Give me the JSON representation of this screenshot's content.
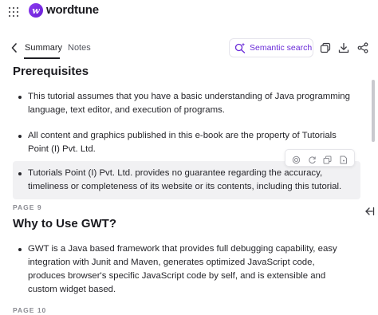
{
  "app": {
    "brand": "wordtune",
    "logo_letter": "w"
  },
  "tabs": [
    {
      "label": "Summary",
      "active": true
    },
    {
      "label": "Notes",
      "active": false
    }
  ],
  "toolbar": {
    "semantic_search_label": "Semantic search",
    "icons": [
      "copy-icon",
      "download-icon",
      "share-icon"
    ]
  },
  "colors": {
    "accent": "#6a2bd8",
    "highlight_bg": "#f1f1f3"
  },
  "sections": [
    {
      "heading": "Prerequisites",
      "bullets": [
        "This tutorial assumes that you have a basic understanding of Java programming language, text editor, and execution of programs.",
        "All content and graphics published in this e-book are the property of Tutorials Point (I) Pvt. Ltd.",
        "Tutorials Point (I) Pvt. Ltd. provides no guarantee regarding the accuracy, timeliness or completeness of its website or its contents, including this tutorial."
      ],
      "page_label": "PAGE 9"
    },
    {
      "heading": "Why to Use GWT?",
      "bullets": [
        "GWT is a Java based framework that provides full debugging capability, easy integration with Junit and Maven, generates optimized JavaScript code, produces browser's specific JavaScript code by self, and is extensible and custom widget based."
      ],
      "page_label": "PAGE 10"
    }
  ],
  "bullet_actions": [
    "target-icon",
    "refresh-icon",
    "copy-icon",
    "note-icon"
  ]
}
